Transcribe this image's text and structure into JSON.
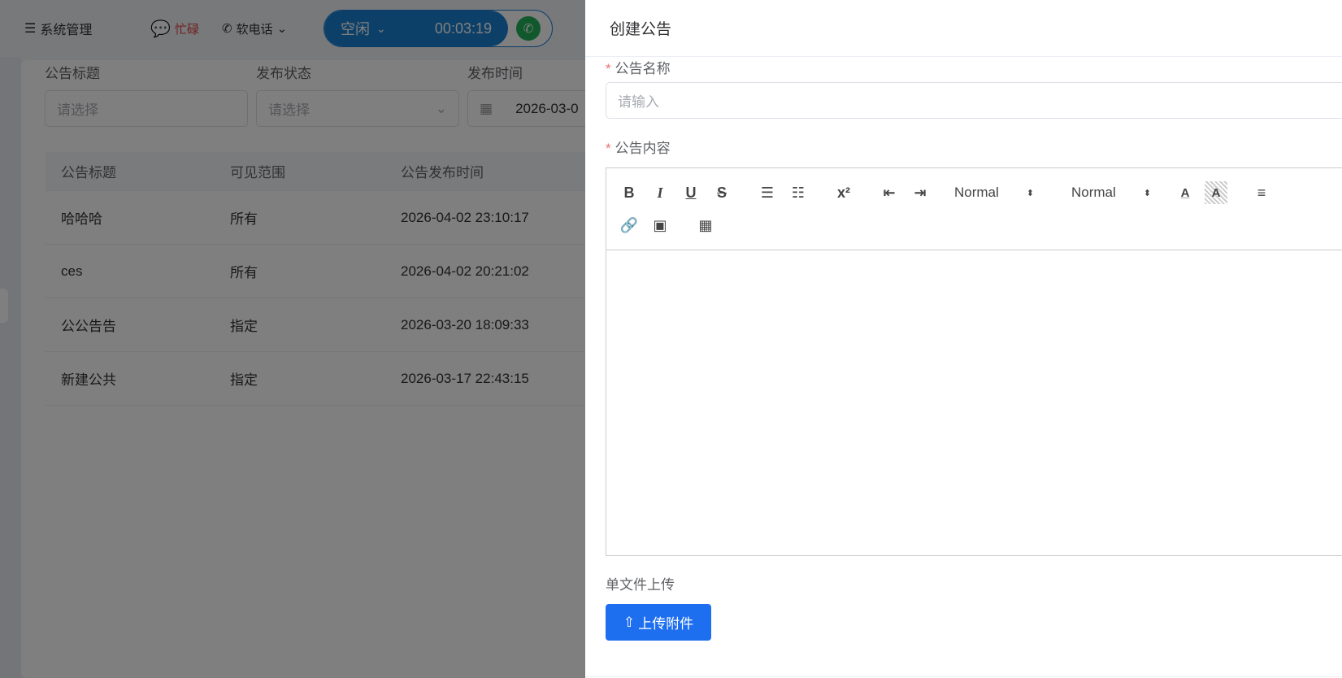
{
  "topbar": {
    "menu": "系统管理",
    "status": "忙碌",
    "softphone": "软电话",
    "call_state": "空闲",
    "timer": "00:03:19"
  },
  "filters": {
    "title_label": "公告标题",
    "title_placeholder": "请选择",
    "status_label": "发布状态",
    "status_placeholder": "请选择",
    "time_label": "发布时间",
    "time_value": "2026-03-0"
  },
  "table": {
    "headers": [
      "公告标题",
      "可见范围",
      "公告发布时间"
    ],
    "rows": [
      [
        "哈哈哈",
        "所有",
        "2026-04-02 23:10:17"
      ],
      [
        "ces",
        "所有",
        "2026-04-02 20:21:02"
      ],
      [
        "公公告告",
        "指定",
        "2026-03-20 18:09:33"
      ],
      [
        "新建公共",
        "指定",
        "2026-03-17 22:43:15"
      ]
    ]
  },
  "drawer": {
    "title": "创建公告",
    "name_label": "公告名称",
    "name_placeholder": "请输入",
    "content_label": "公告内容",
    "required_mark": "*",
    "toolbar": {
      "bold": "B",
      "italic": "I",
      "underline": "U",
      "strike": "S",
      "superscript": "x²",
      "size": "Normal",
      "header": "Normal"
    },
    "upload_label": "单文件上传",
    "upload_button": "上传附件"
  }
}
